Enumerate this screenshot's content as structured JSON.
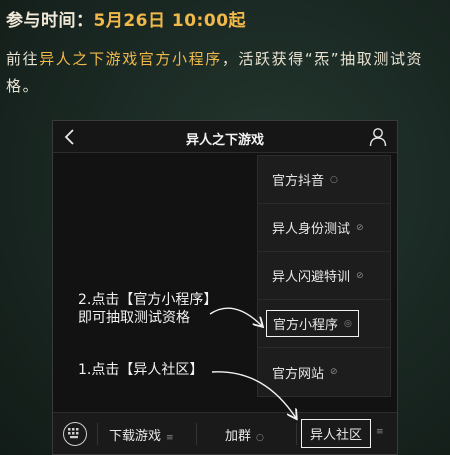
{
  "header": {
    "label": "参与时间：",
    "value": "5月26日 10:00起"
  },
  "description": {
    "prefix": "前往",
    "highlight": "异人之下游戏官方小程序",
    "suffix": "，活跃获得“炁”抽取测试资格。"
  },
  "phone": {
    "title": "异人之下游戏",
    "icons": {
      "back": "back-chevron-icon",
      "profile": "user-icon",
      "keyboard": "keyboard-icon"
    },
    "menu_items": [
      {
        "label": "官方抖音",
        "icon": "○"
      },
      {
        "label": "异人身份测试",
        "icon": "⊘"
      },
      {
        "label": "异人闪避特训",
        "icon": "⊘"
      },
      {
        "label": "官方小程序",
        "icon": "◎"
      },
      {
        "label": "官方网站",
        "icon": "⊘"
      }
    ],
    "bottom_tabs": [
      {
        "label": "下载游戏",
        "icon": "≡"
      },
      {
        "label": "加群",
        "icon": "○"
      },
      {
        "label": "异人社区",
        "icon": "≡"
      }
    ]
  },
  "annotations": {
    "step2_line1": "2.点击【官方小程序】",
    "step2_line2": "即可抽取测试资格",
    "step1": "1.点击【异人社区】"
  },
  "colors": {
    "accent": "#f0b94a",
    "background": "#1b2a24",
    "phone_bg": "#121212"
  }
}
